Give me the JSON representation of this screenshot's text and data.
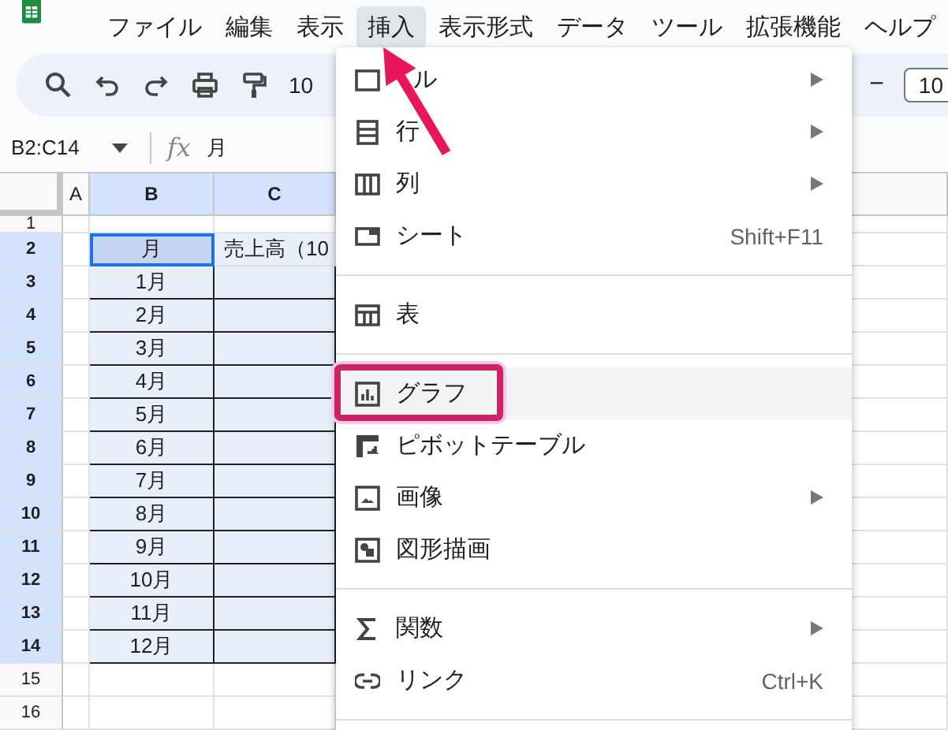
{
  "menubar": [
    {
      "label": "ファイル",
      "selected": false
    },
    {
      "label": "編集",
      "selected": false
    },
    {
      "label": "表示",
      "selected": false
    },
    {
      "label": "挿入",
      "selected": true
    },
    {
      "label": "表示形式",
      "selected": false
    },
    {
      "label": "データ",
      "selected": false
    },
    {
      "label": "ツール",
      "selected": false
    },
    {
      "label": "拡張機能",
      "selected": false
    },
    {
      "label": "ヘルプ",
      "selected": false
    }
  ],
  "toolbar": {
    "zoom": "10",
    "font_size_minus": "−",
    "font_size": "10"
  },
  "formula_bar": {
    "name_box": "B2:C14",
    "function_label": "fx",
    "formula": "月"
  },
  "grid": {
    "columns": [
      {
        "label": "A",
        "selected": false
      },
      {
        "label": "B",
        "selected": true
      },
      {
        "label": "C",
        "selected": true
      }
    ],
    "rows": [
      {
        "header": "1",
        "selected": false,
        "cells": []
      },
      {
        "header": "2",
        "selected": true,
        "cells": [
          "",
          "月",
          "売上高（10"
        ]
      },
      {
        "header": "3",
        "selected": true,
        "cells": [
          "",
          "1月"
        ]
      },
      {
        "header": "4",
        "selected": true,
        "cells": [
          "",
          "2月"
        ]
      },
      {
        "header": "5",
        "selected": true,
        "cells": [
          "",
          "3月"
        ]
      },
      {
        "header": "6",
        "selected": true,
        "cells": [
          "",
          "4月"
        ]
      },
      {
        "header": "7",
        "selected": true,
        "cells": [
          "",
          "5月"
        ]
      },
      {
        "header": "8",
        "selected": true,
        "cells": [
          "",
          "6月"
        ]
      },
      {
        "header": "9",
        "selected": true,
        "cells": [
          "",
          "7月"
        ]
      },
      {
        "header": "10",
        "selected": true,
        "cells": [
          "",
          "8月"
        ]
      },
      {
        "header": "11",
        "selected": true,
        "cells": [
          "",
          "9月"
        ]
      },
      {
        "header": "12",
        "selected": true,
        "cells": [
          "",
          "10月"
        ]
      },
      {
        "header": "13",
        "selected": true,
        "cells": [
          "",
          "11月"
        ]
      },
      {
        "header": "14",
        "selected": true,
        "cells": [
          "",
          "12月"
        ]
      },
      {
        "header": "15",
        "selected": false,
        "cells": []
      },
      {
        "header": "16",
        "selected": false,
        "cells": []
      }
    ]
  },
  "insert_menu": [
    {
      "kind": "item",
      "label": "ル",
      "submenu": true,
      "selected": false
    },
    {
      "kind": "item",
      "label": "行",
      "submenu": true,
      "selected": false
    },
    {
      "kind": "item",
      "label": "列",
      "submenu": true,
      "selected": false
    },
    {
      "kind": "item",
      "label": "シート",
      "shortcut": "Shift+F11",
      "submenu": false,
      "selected": false
    },
    {
      "kind": "divider"
    },
    {
      "kind": "item",
      "label": "表",
      "submenu": false,
      "selected": false
    },
    {
      "kind": "divider"
    },
    {
      "kind": "item",
      "label": "グラフ",
      "submenu": false,
      "selected": true
    },
    {
      "kind": "item",
      "label": "ピボットテーブル",
      "submenu": false,
      "selected": false
    },
    {
      "kind": "item",
      "label": "画像",
      "submenu": true,
      "selected": false
    },
    {
      "kind": "item",
      "label": "図形描画",
      "submenu": false,
      "selected": false
    },
    {
      "kind": "divider"
    },
    {
      "kind": "item",
      "label": "関数",
      "submenu": true,
      "selected": false
    },
    {
      "kind": "item",
      "label": "リンク",
      "shortcut": "Ctrl+K",
      "submenu": false,
      "selected": false
    },
    {
      "kind": "divider"
    }
  ]
}
